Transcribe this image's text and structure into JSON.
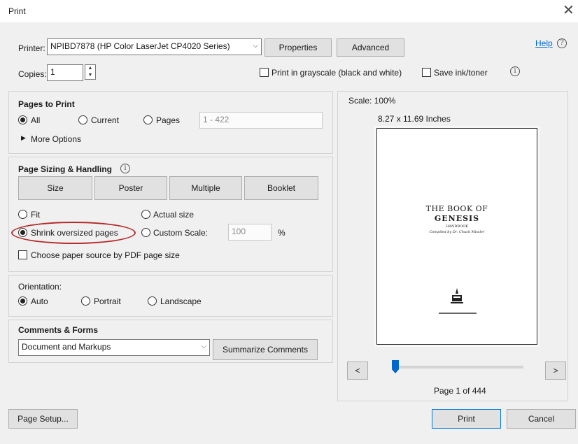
{
  "window": {
    "title": "Print",
    "close_glyph": "✕"
  },
  "printer": {
    "label": "Printer:",
    "selected": "NPIBD7878 (HP Color LaserJet CP4020 Series)",
    "properties_label": "Properties",
    "advanced_label": "Advanced",
    "help_label": "Help"
  },
  "copies": {
    "label": "Copies:",
    "value": "1"
  },
  "options": {
    "grayscale_label": "Print in grayscale (black and white)",
    "save_ink_label": "Save ink/toner"
  },
  "pages_to_print": {
    "title": "Pages to Print",
    "all_label": "All",
    "current_label": "Current",
    "pages_label": "Pages",
    "pages_placeholder": "1 - 422",
    "more_options_label": "More Options",
    "selected": "All"
  },
  "sizing": {
    "title": "Page Sizing & Handling",
    "tabs": [
      "Size",
      "Poster",
      "Multiple",
      "Booklet"
    ],
    "fit_label": "Fit",
    "actual_size_label": "Actual size",
    "shrink_label": "Shrink oversized pages",
    "custom_scale_label": "Custom Scale:",
    "custom_scale_value": "100",
    "percent": "%",
    "paper_source_label": "Choose paper source by PDF page size",
    "selected": "Shrink oversized pages"
  },
  "orientation": {
    "title": "Orientation:",
    "auto_label": "Auto",
    "portrait_label": "Portrait",
    "landscape_label": "Landscape",
    "selected": "Auto"
  },
  "comments": {
    "title": "Comments & Forms",
    "selected": "Document and Markups",
    "summarize_label": "Summarize Comments"
  },
  "preview": {
    "scale": "Scale: 100%",
    "dimensions": "8.27 x 11.69 Inches",
    "book_title_1": "THE BOOK OF",
    "book_title_2": "GENESIS",
    "book_sub": "HANDBOOK",
    "book_author": "Compiled by Dr. Chuck Missler",
    "page_indicator": "Page 1 of 444",
    "prev_label": "<",
    "next_label": ">",
    "slider_fraction": 0.0
  },
  "footer": {
    "page_setup_label": "Page Setup...",
    "print_label": "Print",
    "cancel_label": "Cancel"
  }
}
